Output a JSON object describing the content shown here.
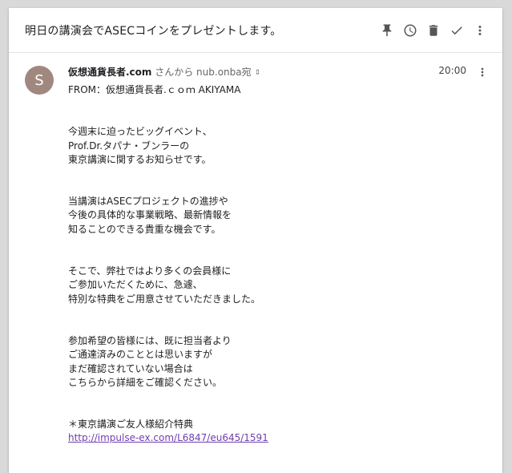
{
  "header": {
    "subject": "明日の講演会でASECコインをプレゼントします。",
    "actions": [
      {
        "name": "pin",
        "icon": "pin-icon"
      },
      {
        "name": "snooze",
        "icon": "clock-icon"
      },
      {
        "name": "delete",
        "icon": "trash-icon"
      },
      {
        "name": "done",
        "icon": "check-icon"
      },
      {
        "name": "more",
        "icon": "more-vert-icon"
      }
    ]
  },
  "message": {
    "avatar_letter": "S",
    "avatar_color": "#a1887f",
    "sender_name": "仮想通貨長者.com",
    "sender_via": " さんから nub.onba宛",
    "time": "20:00",
    "body": {
      "from_line": "FROM：仮想通貨長者.ｃｏｍ AKIYAMA",
      "p1": [
        "今週末に迫ったビッグイベント、",
        "Prof.Dr.タパナ・ブンラーの",
        "東京講演に関するお知らせです。"
      ],
      "p2": [
        "当講演はASECプロジェクトの進捗や",
        "今後の具体的な事業戦略、最新情報を",
        "知ることのできる貴重な機会です。"
      ],
      "p3": [
        "そこで、弊社ではより多くの会員様に",
        "ご参加いただくために、急遽、",
        "特別な特典をご用意させていただきました。"
      ],
      "p4": [
        "参加希望の皆様には、既に担当者より",
        "ご通達済みのこととは思いますが",
        "まだ確認されていない場合は",
        "こちらから詳細をご確認ください。"
      ],
      "p5_title": "＊東京講演ご友人様紹介特典",
      "link": "http://impulse-ex.com/L6847/eu645/1591"
    }
  }
}
